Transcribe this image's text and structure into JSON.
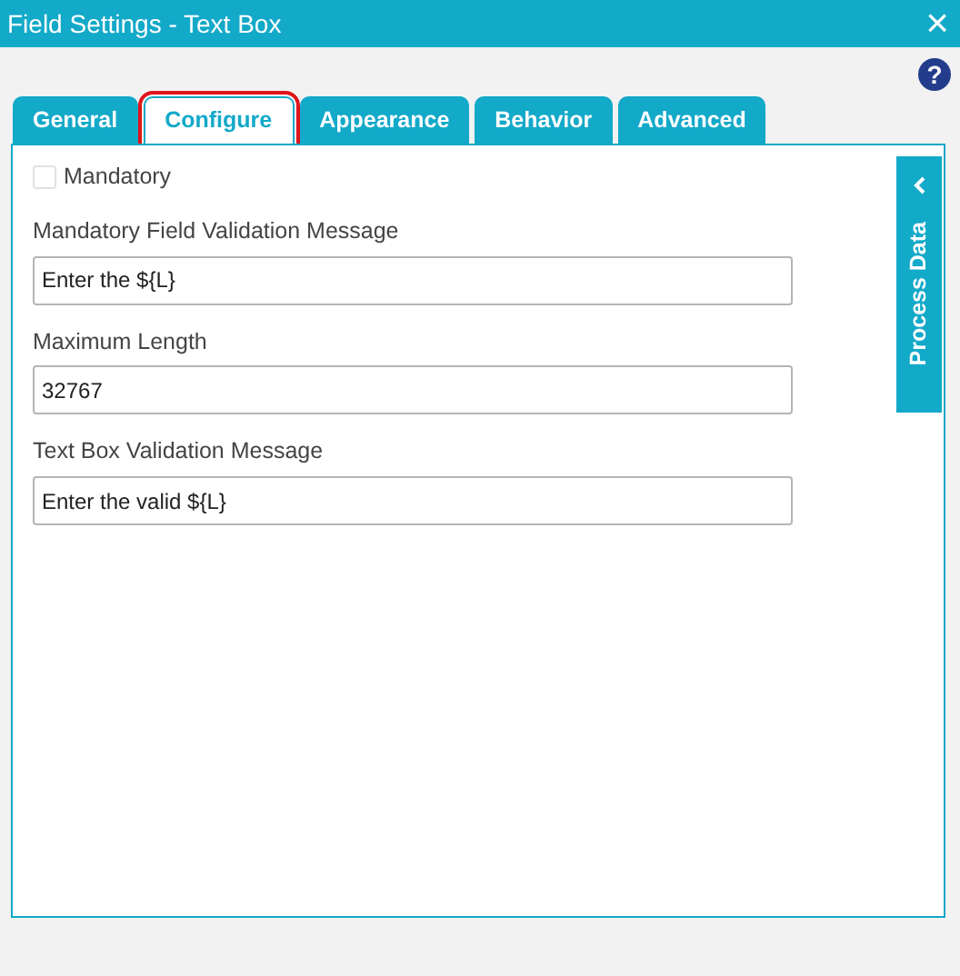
{
  "window": {
    "title": "Field Settings - Text Box",
    "close": "×"
  },
  "help": "?",
  "tabs": [
    {
      "label": "General",
      "selected": false,
      "highlighted": false
    },
    {
      "label": "Configure",
      "selected": true,
      "highlighted": true
    },
    {
      "label": "Appearance",
      "selected": false,
      "highlighted": false
    },
    {
      "label": "Behavior",
      "selected": false,
      "highlighted": false
    },
    {
      "label": "Advanced",
      "selected": false,
      "highlighted": false
    }
  ],
  "fields": [
    {
      "kind": "checkbox",
      "label": "Mandatory",
      "checked": false
    },
    {
      "kind": "text",
      "label": "Mandatory Field Validation Message",
      "value": "Enter the ${L}"
    },
    {
      "kind": "text",
      "label": "Maximum Length",
      "value": "32767"
    },
    {
      "kind": "text",
      "label": "Text Box Validation Message",
      "value": "Enter the valid ${L}"
    }
  ],
  "side_panel": {
    "label": "Process Data",
    "expanded": false
  }
}
